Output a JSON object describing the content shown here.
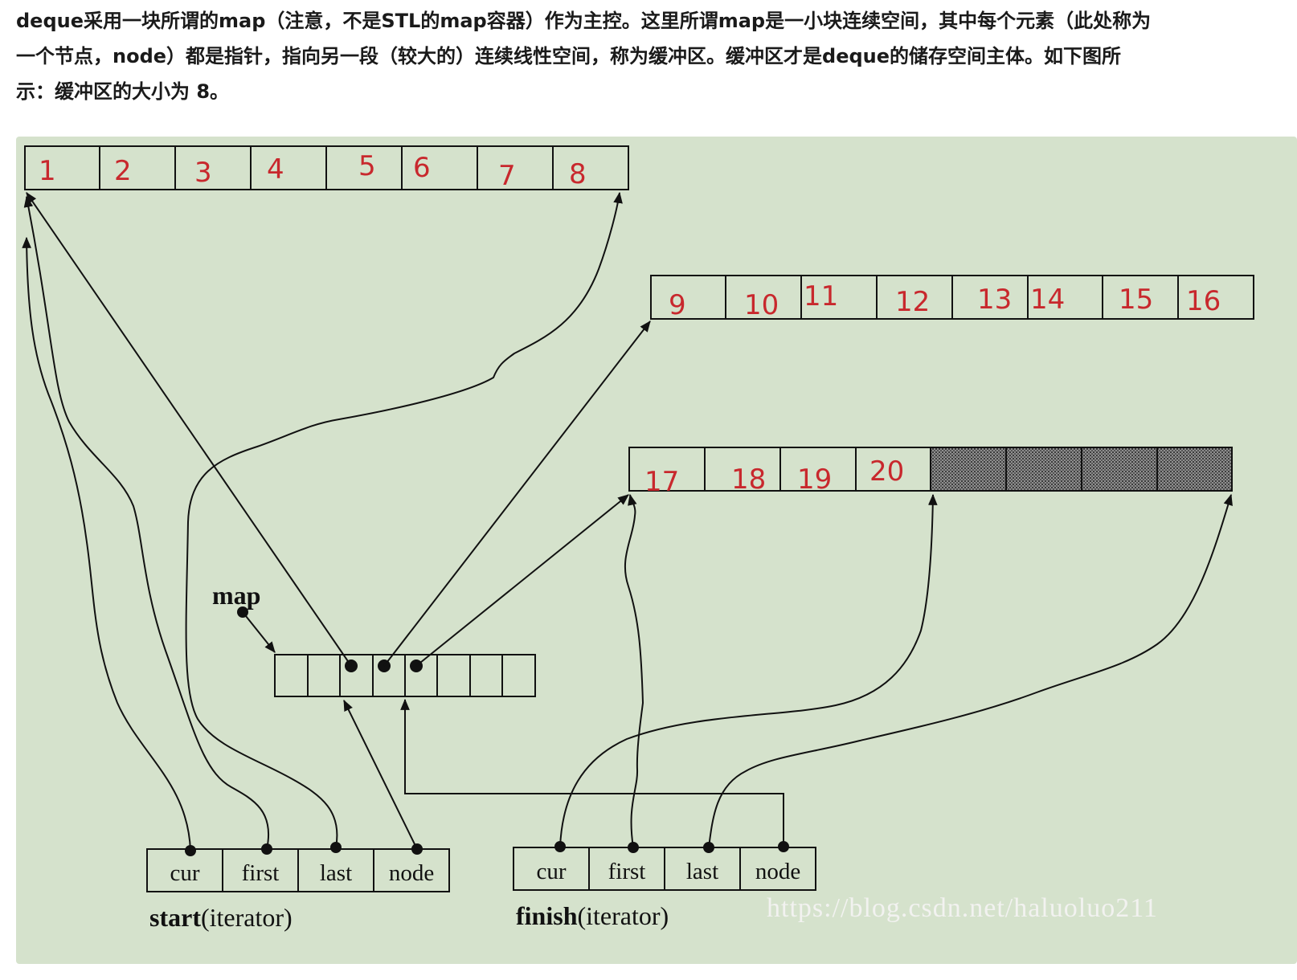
{
  "intro": {
    "line1": "deque采用一块所谓的map（注意，不是STL的map容器）作为主控。这里所谓map是一小块连续空间，其中每个元素（此处称为",
    "line2": "一个节点，node）都是指针，指向另一段（较大的）连续线性空间，称为缓冲区。缓冲区才是deque的储存空间主体。如下图所",
    "line3": "示：缓冲区的大小为 8。"
  },
  "diagram": {
    "buffer1": [
      "1",
      "2",
      "3",
      "4",
      "5",
      "6",
      "7",
      "8"
    ],
    "buffer2": [
      "9",
      "10",
      "11",
      "12",
      "13",
      "14",
      "15",
      "16"
    ],
    "buffer3": [
      "17",
      "18",
      "19",
      "20"
    ],
    "map_label": "map",
    "start_fields": [
      "cur",
      "first",
      "last",
      "node"
    ],
    "finish_fields": [
      "cur",
      "first",
      "last",
      "node"
    ],
    "start_caption_bold": "start",
    "start_caption_rest": "(iterator)",
    "finish_caption_bold": "finish",
    "finish_caption_rest": "(iterator)",
    "watermark": "https://blog.csdn.net/haluoluo211",
    "colors": {
      "background": "#d5e2cc",
      "numbers": "#c8282d",
      "lines": "#111111"
    }
  }
}
